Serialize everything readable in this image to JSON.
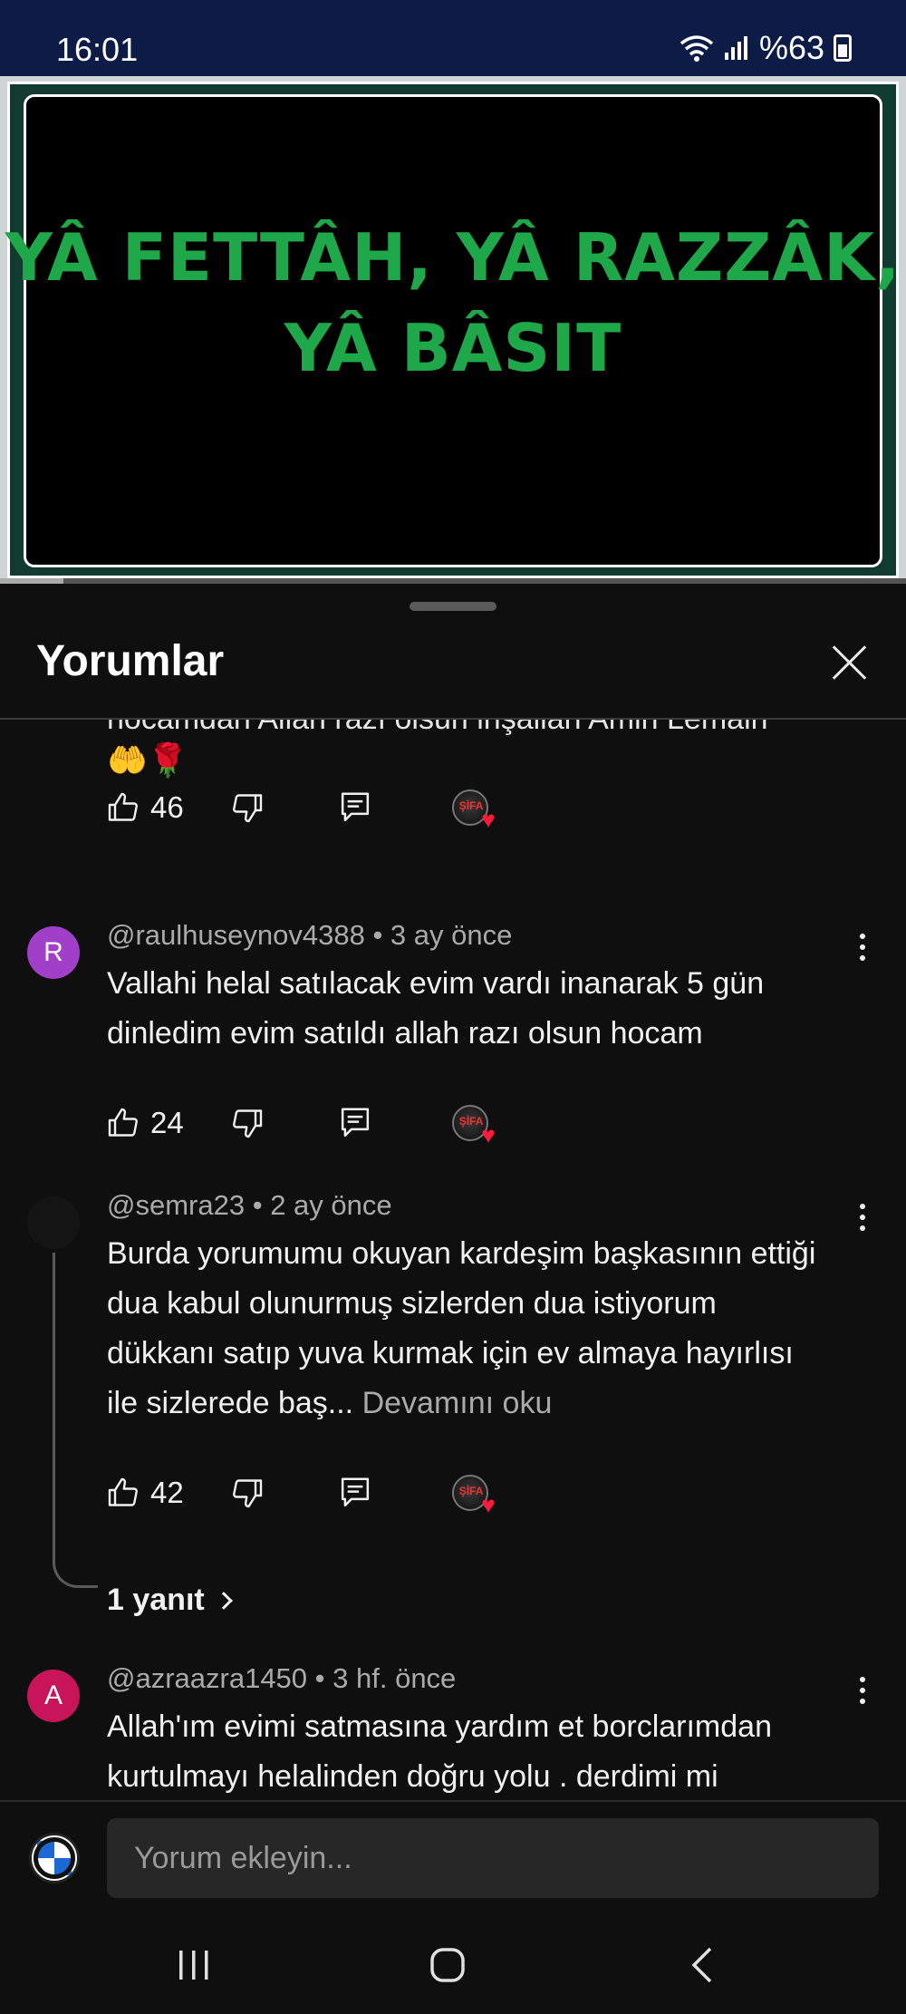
{
  "status_bar": {
    "time": "16:01",
    "battery": "%63"
  },
  "video": {
    "title_line1": "YÂ FETTÂH, YÂ RAZZÂK,",
    "title_line2": "YÂ BÂSIT"
  },
  "sheet": {
    "title": "Yorumlar"
  },
  "comments_top": {
    "cut_text": "hocamdan Allah razı olsun inşallah Amin Lemain",
    "emoji": "🤲🌹",
    "likes": "46"
  },
  "comments": [
    {
      "avatar_letter": "R",
      "avatar_color": "#a23fc9",
      "author": "@raulhuseynov4388",
      "time": "3 ay önce",
      "text": "Vallahi helal satılacak evim vardı inanarak 5 gün dinledim evim satıldı allah razı olsun hocam",
      "likes": "24"
    },
    {
      "avatar_letter": "",
      "avatar_color": "#141414",
      "author": "@semra23",
      "time": "2 ay önce",
      "text": "Burda yorumumu okuyan kardeşim başkasının ettiği dua kabul olunurmuş sizlerden dua istiyorum dükkanı satıp yuva kurmak için ev almaya hayırlısı ile sizlerede baş...",
      "read_more": "Devamını oku",
      "likes": "42",
      "replies": "1 yanıt"
    },
    {
      "avatar_letter": "A",
      "avatar_color": "#c8155a",
      "author": "@azraazra1450",
      "time": "3 hf. önce",
      "text": "Allah'ım evimi satmasına yardım et borclarımdan kurtulmayı helalinden doğru yolu . derdimi mi"
    }
  ],
  "input": {
    "placeholder": "Yorum ekleyin..."
  },
  "badge_text": "ŞİFA"
}
